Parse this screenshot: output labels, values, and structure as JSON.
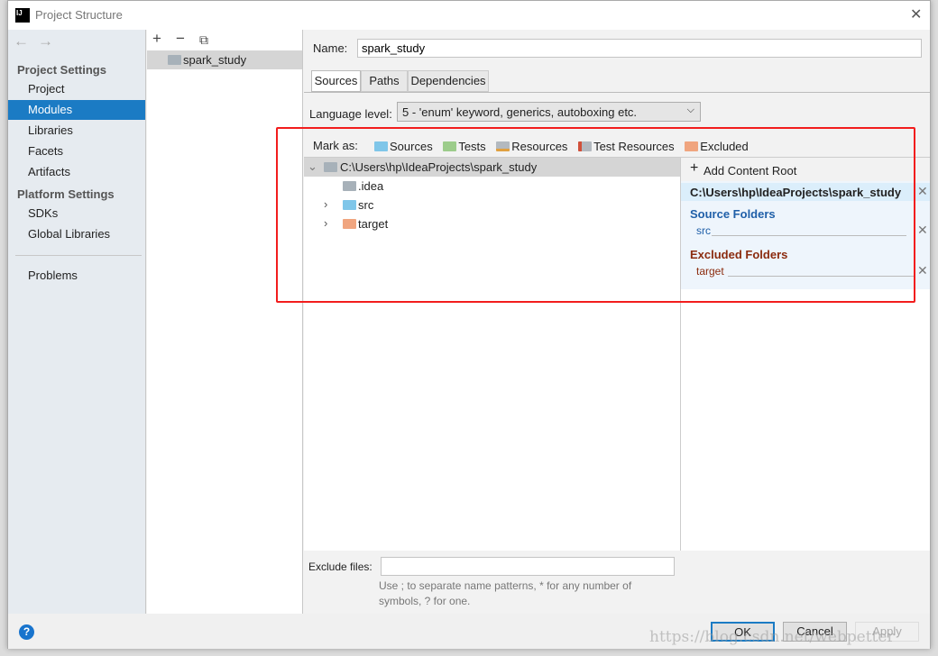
{
  "window": {
    "title": "Project Structure",
    "close": "✕"
  },
  "sidebar": {
    "project_settings": "Project Settings",
    "items": [
      "Project",
      "Modules",
      "Libraries",
      "Facets",
      "Artifacts"
    ],
    "platform_settings": "Platform Settings",
    "platform_items": [
      "SDKs",
      "Global Libraries"
    ],
    "problems": "Problems"
  },
  "modules": {
    "items": [
      "spark_study"
    ]
  },
  "main": {
    "name_label": "Name:",
    "name_value": "spark_study",
    "tabs": [
      "Sources",
      "Paths",
      "Dependencies"
    ],
    "language_level_label": "Language level:",
    "language_level_value": "5 - 'enum' keyword, generics, autoboxing etc.",
    "mark_as_label": "Mark as:",
    "mark_as": [
      {
        "label": "Sources",
        "color": "#7fc6e9"
      },
      {
        "label": "Tests",
        "color": "#9ccc8b"
      },
      {
        "label": "Resources",
        "color": "#b3b9bf"
      },
      {
        "label": "Test Resources",
        "color": "#b3b9bf"
      },
      {
        "label": "Excluded",
        "color": "#f0a57f"
      }
    ],
    "tree": {
      "root": "C:\\Users\\hp\\IdeaProjects\\spark_study",
      "children": [
        ".idea",
        "src",
        "target"
      ]
    },
    "content_root": {
      "add": "Add Content Root",
      "path": "C:\\Users\\hp\\IdeaProjects\\spark_study",
      "source_folders_title": "Source Folders",
      "source_folders": [
        "src"
      ],
      "excluded_folders_title": "Excluded Folders",
      "excluded_folders": [
        "target"
      ]
    },
    "exclude_files_label": "Exclude files:",
    "exclude_files_value": "",
    "hint_line1": "Use ; to separate name patterns, * for any number of",
    "hint_line2": "symbols, ? for one."
  },
  "buttons": {
    "ok": "OK",
    "cancel": "Cancel",
    "apply": "Apply",
    "help": "?"
  },
  "watermark": "https://blog.csdn.net/webpetter"
}
